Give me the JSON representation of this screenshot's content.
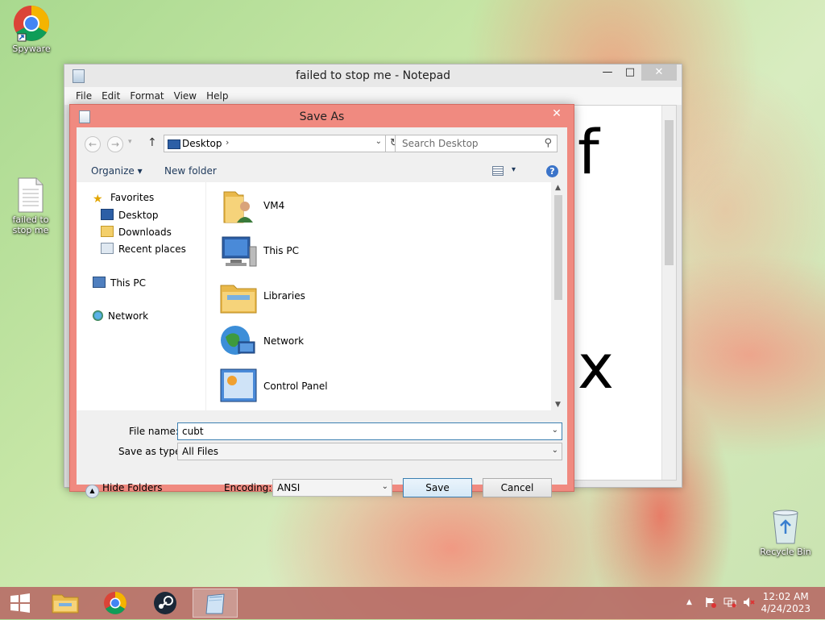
{
  "desktop": {
    "icons": [
      {
        "label": "Spyware",
        "icon": "chrome-icon"
      },
      {
        "label": "failed to stop me",
        "icon": "text-file-icon"
      },
      {
        "label": "Recycle Bin",
        "icon": "recycle-bin-icon"
      }
    ]
  },
  "notepad": {
    "title": "failed to stop me - Notepad",
    "window_controls": {
      "minimize": "—",
      "maximize": "□",
      "close": "✕"
    },
    "menu": [
      "File",
      "Edit",
      "Format",
      "View",
      "Help"
    ],
    "text_lines": [
      "f",
      "x"
    ]
  },
  "save_as": {
    "title": "Save As",
    "close": "✕",
    "nav": {
      "back": "←",
      "forward": "→",
      "recent": "▾",
      "up": "↑"
    },
    "address": {
      "location": "Desktop",
      "chevron": "›",
      "dropdown": "⌄",
      "refresh": "↻"
    },
    "search_placeholder": "Search Desktop",
    "toolbar": {
      "organize": "Organize ▾",
      "new_folder": "New folder",
      "view": "▾",
      "help": "?"
    },
    "nav_pane": {
      "favorites": "Favorites",
      "favorites_items": [
        "Desktop",
        "Downloads",
        "Recent places"
      ],
      "this_pc": "This PC",
      "network": "Network"
    },
    "files": [
      "VM4",
      "This PC",
      "Libraries",
      "Network",
      "Control Panel"
    ],
    "file_name_label": "File name:",
    "file_name_value": "cubt",
    "save_as_type_label": "Save as type:",
    "save_as_type_value": "All Files",
    "hide_folders": "Hide Folders",
    "encoding_label": "Encoding:",
    "encoding_value": "ANSI",
    "save_button": "Save",
    "cancel_button": "Cancel"
  },
  "taskbar": {
    "time": "12:02 AM",
    "date": "4/24/2023",
    "tray_expand": "▲"
  },
  "colors": {
    "dialog_frame": "#f08a80",
    "taskbar": "#b76e67",
    "accent_blue": "#3c7fb1"
  }
}
